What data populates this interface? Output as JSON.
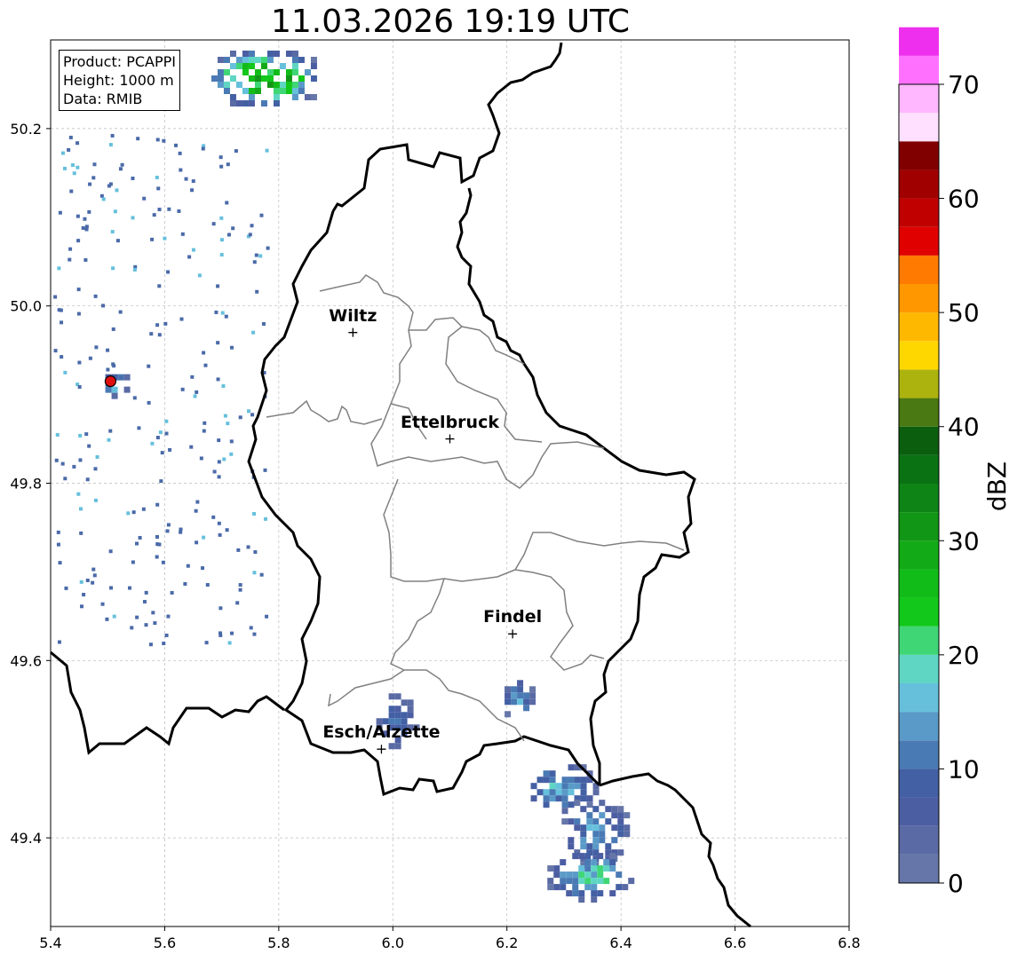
{
  "title": "11.03.2026 19:19 UTC",
  "info": {
    "product": "Product: PCAPPI",
    "height": "Height: 1000 m",
    "data": "Data: RMIB"
  },
  "axes": {
    "x_ticks": [
      "5.4",
      "5.6",
      "5.8",
      "6.0",
      "6.2",
      "6.4",
      "6.6",
      "6.8"
    ],
    "y_ticks": [
      "49.4",
      "49.6",
      "49.8",
      "50.0",
      "50.2"
    ],
    "xlim": [
      5.4,
      6.8
    ],
    "ylim": [
      49.3,
      50.3
    ],
    "grid": true
  },
  "cities": [
    {
      "name": "Wiltz",
      "lon": 5.93,
      "lat": 49.97
    },
    {
      "name": "Ettelbruck",
      "lon": 6.1,
      "lat": 49.85
    },
    {
      "name": "Findel",
      "lon": 6.21,
      "lat": 49.63
    },
    {
      "name": "Esch/Alzette",
      "lon": 5.98,
      "lat": 49.5
    }
  ],
  "radar_site": {
    "lon": 5.505,
    "lat": 49.915,
    "color": "#e01010"
  },
  "colorbar": {
    "label": "dBZ",
    "ticks": [
      "0",
      "10",
      "20",
      "30",
      "40",
      "50",
      "60",
      "70"
    ],
    "min": 0,
    "max": 70,
    "step": 2.5,
    "colors": [
      "#6676a8",
      "#5a6aa4",
      "#4c5ea2",
      "#4460a4",
      "#4a7ab4",
      "#5a9ac8",
      "#66c0dc",
      "#5fd6c4",
      "#3fd676",
      "#12c81a",
      "#12bc18",
      "#12aa16",
      "#129616",
      "#0e8416",
      "#0a7212",
      "#0a5e0e",
      "#4a7812",
      "#adb30e",
      "#ffd700",
      "#ffb800",
      "#ff9800",
      "#ff7a00",
      "#e00000",
      "#c00000",
      "#a00000",
      "#800000",
      "#ffe0ff",
      "#ffb8ff",
      "#ff70ff",
      "#ee30ee"
    ]
  },
  "echoes": [
    {
      "name": "north-cluster",
      "lon": 5.77,
      "lat": 50.26,
      "w": 0.22,
      "h": 0.07,
      "peak": 34
    },
    {
      "name": "esch-cluster",
      "lon": 6.0,
      "lat": 49.535,
      "w": 0.08,
      "h": 0.07,
      "peak": 11
    },
    {
      "name": "south-cluster-a",
      "lon": 6.29,
      "lat": 49.46,
      "w": 0.14,
      "h": 0.06,
      "peak": 18
    },
    {
      "name": "south-cluster-b",
      "lon": 6.35,
      "lat": 49.41,
      "w": 0.13,
      "h": 0.08,
      "peak": 16
    },
    {
      "name": "south-cluster-c",
      "lon": 6.34,
      "lat": 49.36,
      "w": 0.16,
      "h": 0.06,
      "peak": 22
    },
    {
      "name": "findel-south",
      "lon": 6.215,
      "lat": 49.56,
      "w": 0.06,
      "h": 0.05,
      "peak": 15
    },
    {
      "name": "radar-clutter",
      "lon": 5.51,
      "lat": 49.915,
      "w": 0.05,
      "h": 0.03,
      "peak": 20
    }
  ]
}
